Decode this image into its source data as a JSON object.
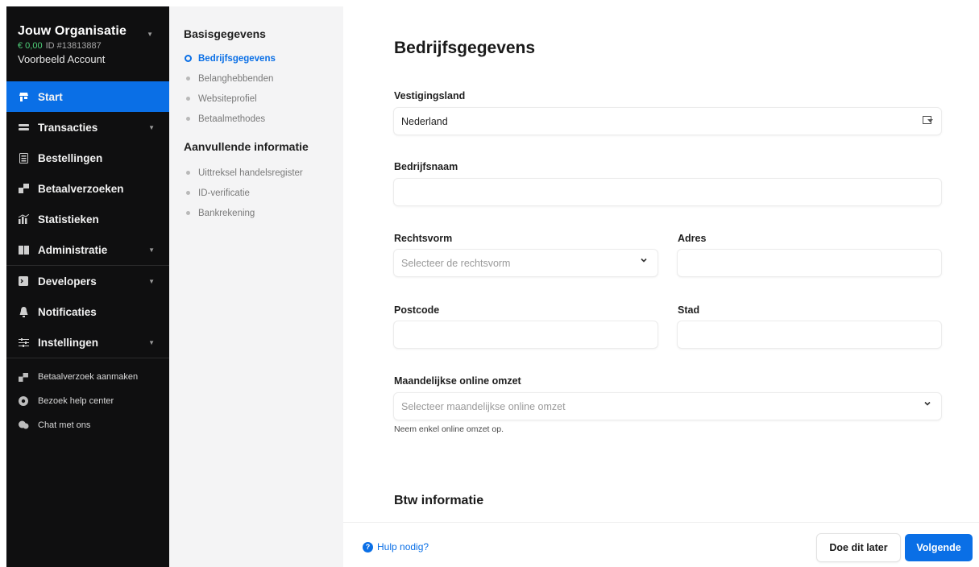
{
  "org": {
    "name": "Jouw Organisatie",
    "balance": "€ 0,00",
    "id_text": "ID #13813887",
    "account": "Voorbeeld Account"
  },
  "nav": {
    "items": [
      {
        "label": "Start",
        "icon": "store-icon"
      },
      {
        "label": "Transacties",
        "icon": "transactions-icon"
      },
      {
        "label": "Bestellingen",
        "icon": "orders-icon"
      },
      {
        "label": "Betaalverzoeken",
        "icon": "payment-request-icon"
      },
      {
        "label": "Statistieken",
        "icon": "statistics-icon"
      },
      {
        "label": "Administratie",
        "icon": "book-icon"
      },
      {
        "label": "Developers",
        "icon": "terminal-icon"
      },
      {
        "label": "Notificaties",
        "icon": "bell-icon"
      },
      {
        "label": "Instellingen",
        "icon": "sliders-icon"
      }
    ],
    "links": [
      {
        "label": "Betaalverzoek aanmaken",
        "icon": "payment-request-icon"
      },
      {
        "label": "Bezoek help center",
        "icon": "help-icon"
      },
      {
        "label": "Chat met ons",
        "icon": "chat-icon"
      }
    ]
  },
  "steps": {
    "group1": "Basisgegevens",
    "group1_items": [
      "Bedrijfsgegevens",
      "Belanghebbenden",
      "Websiteprofiel",
      "Betaalmethodes"
    ],
    "group2": "Aanvullende informatie",
    "group2_items": [
      "Uittreksel handelsregister",
      "ID-verificatie",
      "Bankrekening"
    ]
  },
  "form": {
    "title": "Bedrijfsgegevens",
    "country_label": "Vestigingsland",
    "country_value": "Nederland",
    "company_label": "Bedrijfsnaam",
    "company_value": "",
    "legal_label": "Rechtsvorm",
    "legal_placeholder": "Selecteer de rechtsvorm",
    "address_label": "Adres",
    "postcode_label": "Postcode",
    "city_label": "Stad",
    "turnover_label": "Maandelijkse online omzet",
    "turnover_placeholder": "Selecteer maandelijkse online omzet",
    "turnover_hint": "Neem enkel online omzet op.",
    "vat_title": "Btw informatie"
  },
  "footer": {
    "help": "Hulp nodig?",
    "later": "Doe dit later",
    "next": "Volgende"
  },
  "colors": {
    "accent": "#0a6fe6",
    "sidebar_bg": "#0f0f10",
    "balance": "#4fd27a"
  }
}
